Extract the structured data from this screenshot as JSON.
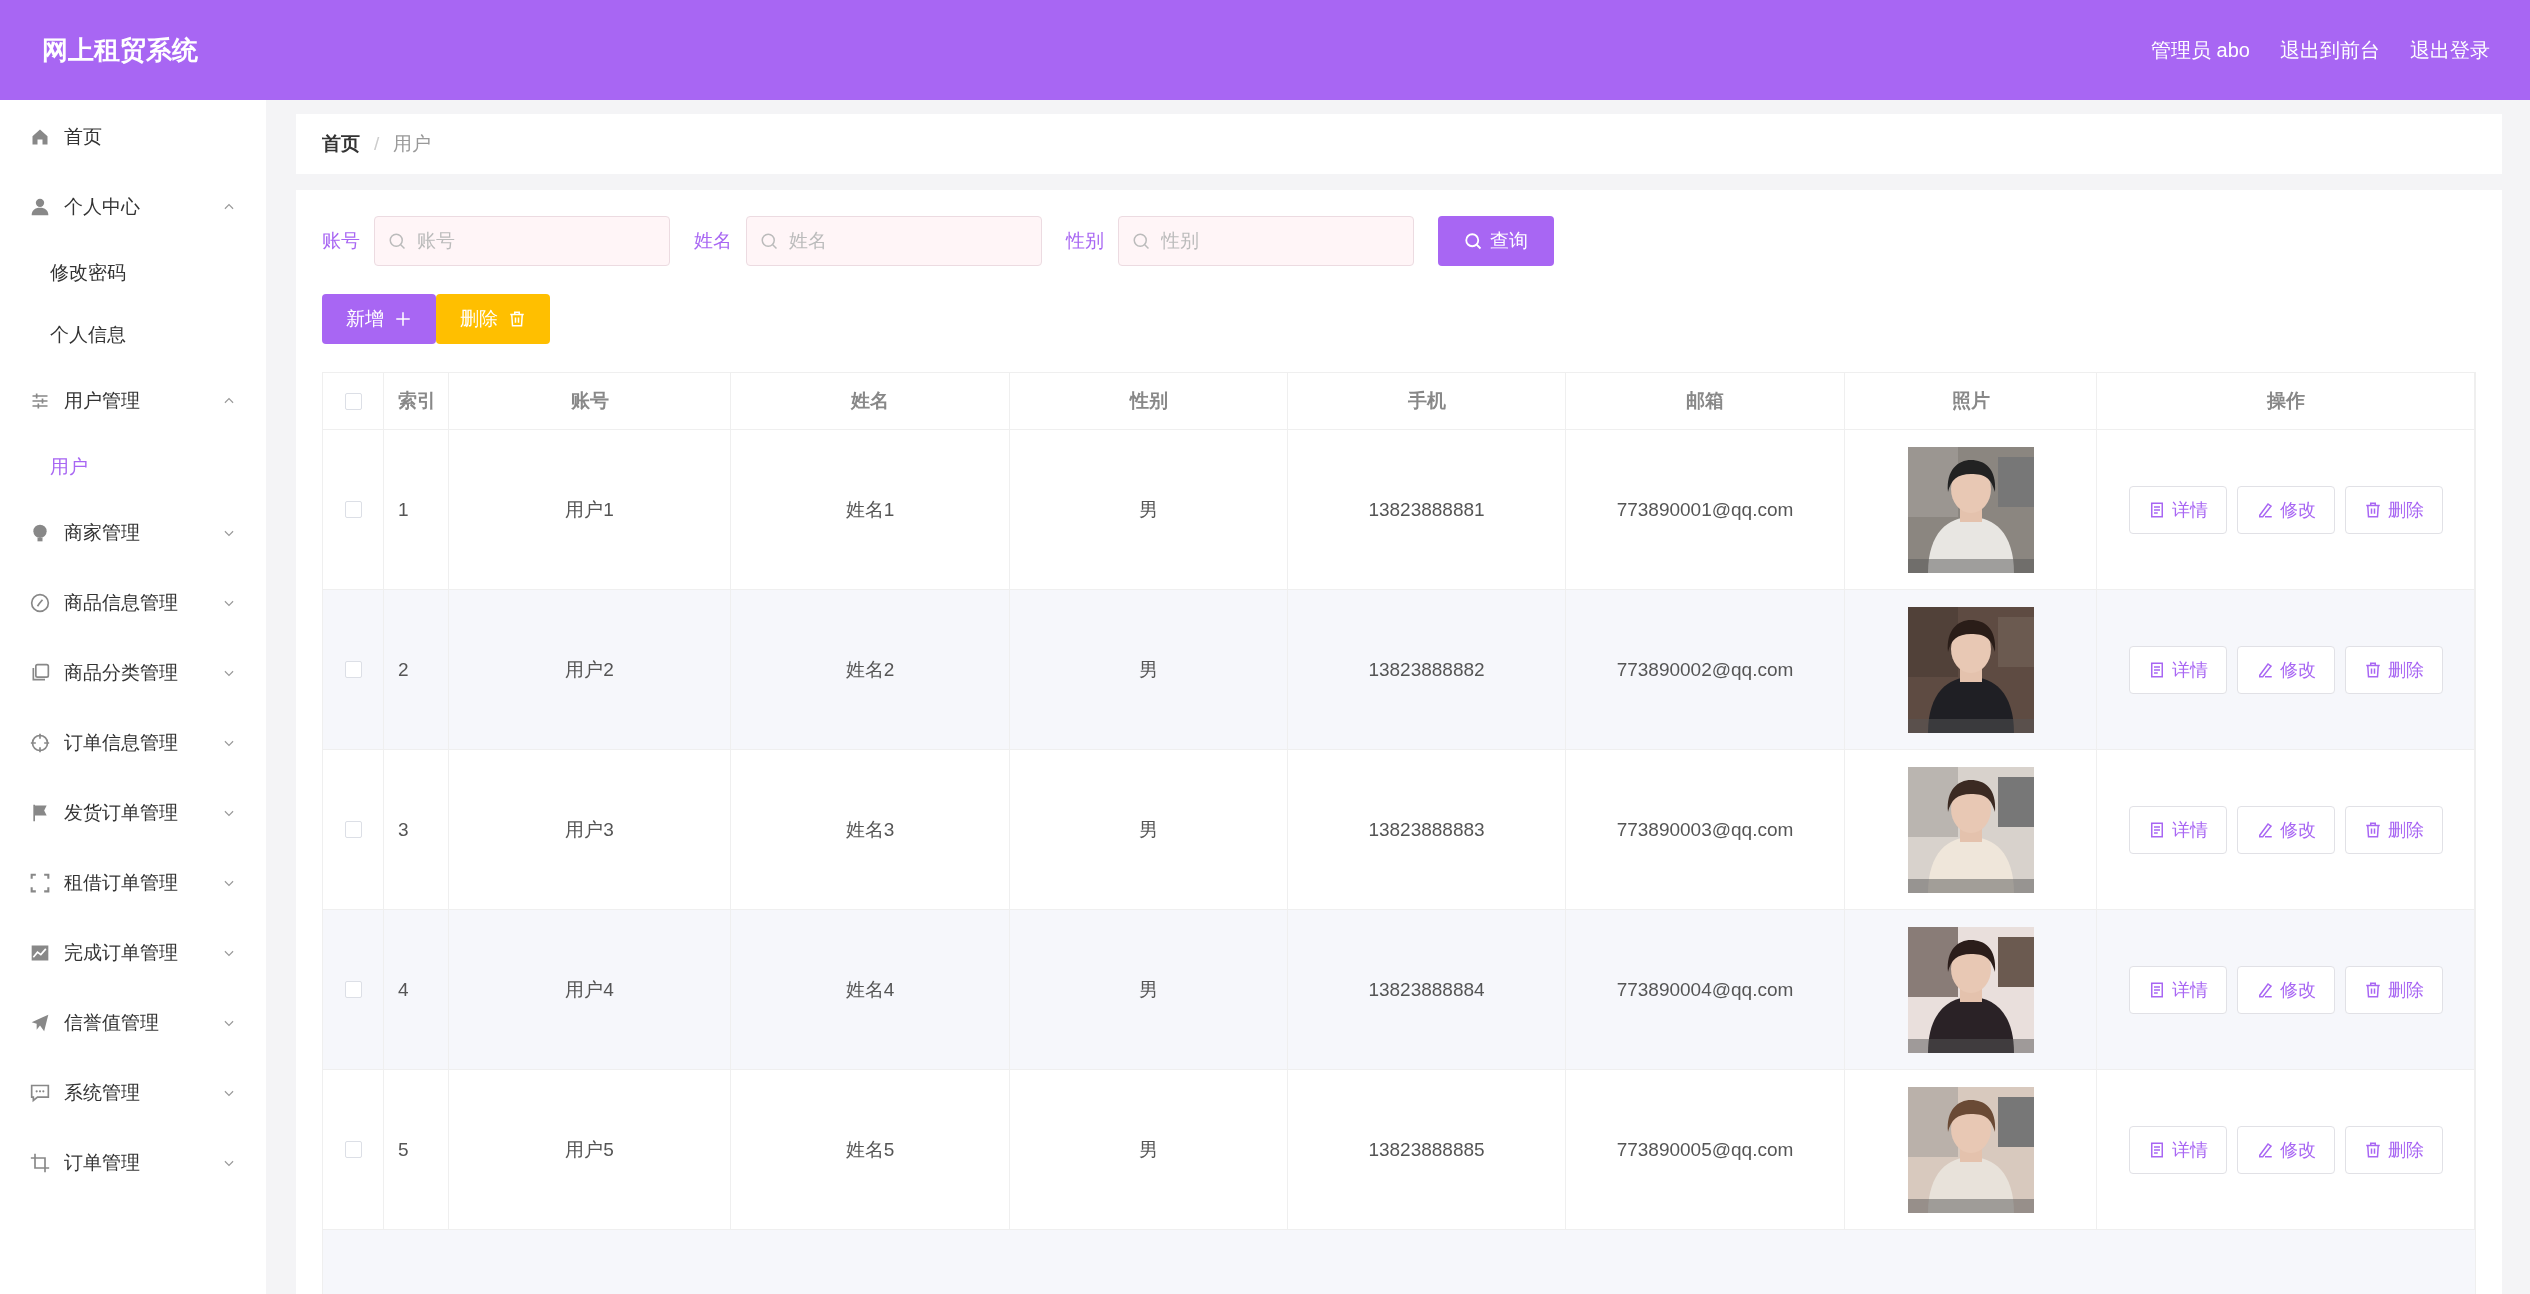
{
  "header": {
    "title": "网上租贸系统",
    "user": "管理员 abo",
    "links": [
      "退出到前台",
      "退出登录"
    ]
  },
  "sidebar": {
    "items": [
      {
        "label": "首页"
      },
      {
        "label": "个人中心",
        "expanded": true,
        "children": [
          {
            "label": "修改密码",
            "selected": false
          },
          {
            "label": "个人信息",
            "selected": false
          }
        ]
      },
      {
        "label": "用户管理",
        "expanded": true,
        "children": [
          {
            "label": "用户",
            "selected": true
          }
        ]
      },
      {
        "label": "商家管理",
        "expanded": false
      },
      {
        "label": "商品信息管理",
        "expanded": false
      },
      {
        "label": "商品分类管理",
        "expanded": false
      },
      {
        "label": "订单信息管理",
        "expanded": false
      },
      {
        "label": "发货订单管理",
        "expanded": false
      },
      {
        "label": "租借订单管理",
        "expanded": false
      },
      {
        "label": "完成订单管理",
        "expanded": false
      },
      {
        "label": "信誉值管理",
        "expanded": false
      },
      {
        "label": "系统管理",
        "expanded": false
      },
      {
        "label": "订单管理",
        "expanded": false
      }
    ]
  },
  "breadcrumb": {
    "items": [
      "首页",
      "用户"
    ],
    "separator": "/"
  },
  "search": {
    "fields": [
      {
        "label": "账号",
        "placeholder": "账号"
      },
      {
        "label": "姓名",
        "placeholder": "姓名"
      },
      {
        "label": "性别",
        "placeholder": "性别"
      }
    ],
    "button": "查询"
  },
  "toolbar": {
    "add": "新增",
    "delete": "删除"
  },
  "table": {
    "select_all_checked": false,
    "columns": [
      "索引",
      "账号",
      "姓名",
      "性别",
      "手机",
      "邮箱",
      "照片",
      "操作"
    ],
    "rows": [
      {
        "checked": false,
        "index": "1",
        "account": "用户1",
        "name": "姓名1",
        "gender": "男",
        "phone": "13823888881",
        "email": "773890001@qq.com",
        "actions": [
          "详情",
          "修改",
          "删除"
        ]
      },
      {
        "checked": false,
        "index": "2",
        "account": "用户2",
        "name": "姓名2",
        "gender": "男",
        "phone": "13823888882",
        "email": "773890002@qq.com",
        "actions": [
          "详情",
          "修改",
          "删除"
        ]
      },
      {
        "checked": false,
        "index": "3",
        "account": "用户3",
        "name": "姓名3",
        "gender": "男",
        "phone": "13823888883",
        "email": "773890003@qq.com",
        "actions": [
          "详情",
          "修改",
          "删除"
        ]
      },
      {
        "checked": false,
        "index": "4",
        "account": "用户4",
        "name": "姓名4",
        "gender": "男",
        "phone": "13823888884",
        "email": "773890004@qq.com",
        "actions": [
          "详情",
          "修改",
          "删除"
        ]
      },
      {
        "checked": false,
        "index": "5",
        "account": "用户5",
        "name": "姓名5",
        "gender": "男",
        "phone": "13823888885",
        "email": "773890005@qq.com",
        "actions": [
          "详情",
          "修改",
          "删除"
        ]
      }
    ]
  }
}
